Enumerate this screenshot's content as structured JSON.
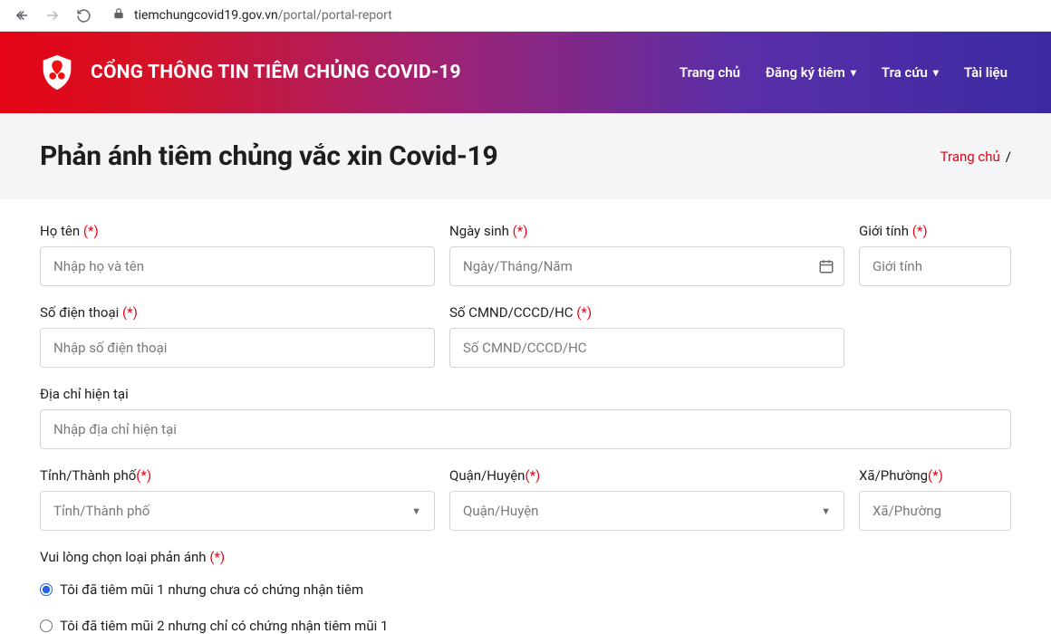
{
  "browser": {
    "host": "tiemchungcovid19.gov.vn",
    "path": "/portal/portal-report"
  },
  "header": {
    "title": "CỔNG THÔNG TIN TIÊM CHỦNG COVID-19",
    "nav": {
      "home": "Trang chủ",
      "register": "Đăng ký tiêm",
      "lookup": "Tra cứu",
      "docs": "Tài liệu"
    }
  },
  "page": {
    "title": "Phản ánh tiêm chủng vắc xin Covid-19",
    "breadcrumb_home": "Trang chủ"
  },
  "form": {
    "required_mark": "(*)",
    "fullname": {
      "label": "Họ tên",
      "placeholder": "Nhập họ và tên"
    },
    "dob": {
      "label": "Ngày sinh",
      "placeholder": "Ngày/Tháng/Năm"
    },
    "gender": {
      "label": "Giới tính",
      "placeholder": "Giới tính"
    },
    "phone": {
      "label": "Số điện thoại",
      "placeholder": "Nhập số điện thoại"
    },
    "idnum": {
      "label": "Số CMND/CCCD/HC",
      "placeholder": "Số CMND/CCCD/HC"
    },
    "address": {
      "label": "Địa chỉ hiện tại",
      "placeholder": "Nhập địa chỉ hiện tại"
    },
    "province": {
      "label": "Tỉnh/Thành phố",
      "placeholder": "Tỉnh/Thành phố"
    },
    "district": {
      "label": "Quận/Huyện",
      "placeholder": "Quận/Huyện"
    },
    "ward": {
      "label": "Xã/Phường",
      "placeholder": "Xã/Phường"
    },
    "feedback_type": {
      "title": "Vui lòng chọn loại phản ánh",
      "opt1": "Tôi đã tiêm mũi 1 nhưng chưa có chứng nhận tiêm",
      "opt2": "Tôi đã tiêm mũi 2 nhưng chỉ có chứng nhận tiêm mũi 1"
    }
  }
}
